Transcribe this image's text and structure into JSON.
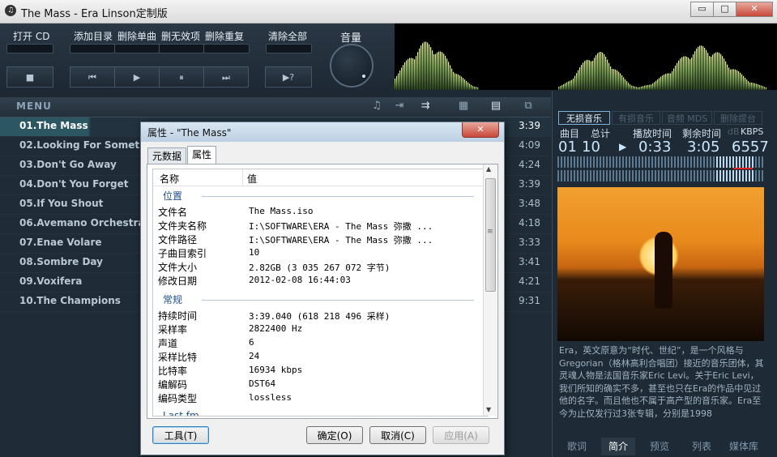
{
  "window": {
    "title": "The Mass - Era  Linson定制版",
    "app_icon": "♫",
    "minimize": "▭",
    "maximize": "□",
    "close": "✕"
  },
  "toolbar": {
    "open_cd": "打开 CD",
    "add_dir": "添加目录",
    "del_single": "删除单曲",
    "del_invalid": "删无效项",
    "del_dup": "删除重复",
    "clear_all": "清除全部",
    "volume": "音量",
    "stop_icon": "■",
    "prev_icon": "⏮",
    "play_icon": "▶",
    "pause_icon": "⏸",
    "next_icon": "⏭",
    "random_icon": "▶?"
  },
  "menubar": {
    "menu": "MENU",
    "icons": [
      "♫",
      "⇥",
      "⇉",
      "▦",
      "▤",
      "⧉"
    ]
  },
  "playlist": [
    {
      "title": "01.The Mass",
      "duration": "3:39",
      "selected": true
    },
    {
      "title": "02.Looking For Something",
      "duration": "4:09"
    },
    {
      "title": "03.Don't Go Away",
      "duration": "4:24"
    },
    {
      "title": "04.Don't You Forget",
      "duration": "3:39"
    },
    {
      "title": "05.If You Shout",
      "duration": "3:48"
    },
    {
      "title": "06.Avemano Orchestral",
      "duration": "4:18"
    },
    {
      "title": "07.Enae Volare",
      "duration": "3:33"
    },
    {
      "title": "08.Sombre Day",
      "duration": "3:41"
    },
    {
      "title": "09.Voxifera",
      "duration": "4:21"
    },
    {
      "title": "10.The Champions",
      "duration": "9:31"
    }
  ],
  "right_panel": {
    "tabs": [
      "无损音乐",
      "有损音乐",
      "音频 MDS",
      "删除提台"
    ],
    "headers": {
      "track": "曲目",
      "total": "总计",
      "played": "播放时间",
      "remaining": "剩余时间",
      "db": "dB",
      "kbps": "KBPS"
    },
    "values": {
      "track": "01",
      "total": "10",
      "play_icon": "▶",
      "played": "0:33",
      "remaining": "3:05",
      "kbps": "6557"
    },
    "bio": "Era，英文原意为“时代、世纪”，是一个风格与Gregorian（格林高利合唱团）接近的音乐团体，其灵魂人物是法国音乐家Eric Levi。关于Eric Levi，我们所知的确实不多，甚至也只在Era的作品中见过他的名字。而且他也不属于高产型的音乐家。Era至今为止仅发行过3张专辑，分别是1998",
    "bottom_tabs": [
      "歌词",
      "简介",
      "预览",
      "列表",
      "媒体库"
    ],
    "active_bottom": 1
  },
  "dialog": {
    "title": "属性 - \"The Mass\"",
    "close": "✕",
    "tabs": [
      "元数据",
      "属性"
    ],
    "col_name": "名称",
    "col_value": "值",
    "sections": [
      {
        "title": "位置",
        "rows": [
          {
            "k": "文件名",
            "v": "The Mass.iso"
          },
          {
            "k": "文件夹名称",
            "v": "I:\\SOFTWARE\\ERA - The Mass 弥撒 ..."
          },
          {
            "k": "文件路径",
            "v": "I:\\SOFTWARE\\ERA - The Mass 弥撒 ..."
          },
          {
            "k": "子曲目索引",
            "v": "10"
          },
          {
            "k": "文件大小",
            "v": "2.82GB (3 035 267 072 字节)"
          },
          {
            "k": "修改日期",
            "v": "2012-02-08 16:44:03"
          }
        ]
      },
      {
        "title": "常规",
        "rows": [
          {
            "k": "持续时间",
            "v": "3:39.040 (618 218 496 采样)"
          },
          {
            "k": "采样率",
            "v": "2822400 Hz"
          },
          {
            "k": "声道",
            "v": "6"
          },
          {
            "k": "采样比特",
            "v": "24"
          },
          {
            "k": "比特率",
            "v": "16934 kbps"
          },
          {
            "k": "编解码",
            "v": "DST64"
          },
          {
            "k": "编码类型",
            "v": "lossless"
          }
        ]
      },
      {
        "title": "Last.fm",
        "rows": []
      }
    ],
    "buttons": {
      "tools": "工具(T)",
      "ok": "确定(O)",
      "cancel": "取消(C)",
      "apply": "应用(A)"
    },
    "scroll_up": "▲",
    "scroll_down": "▼",
    "grip": "≡"
  }
}
